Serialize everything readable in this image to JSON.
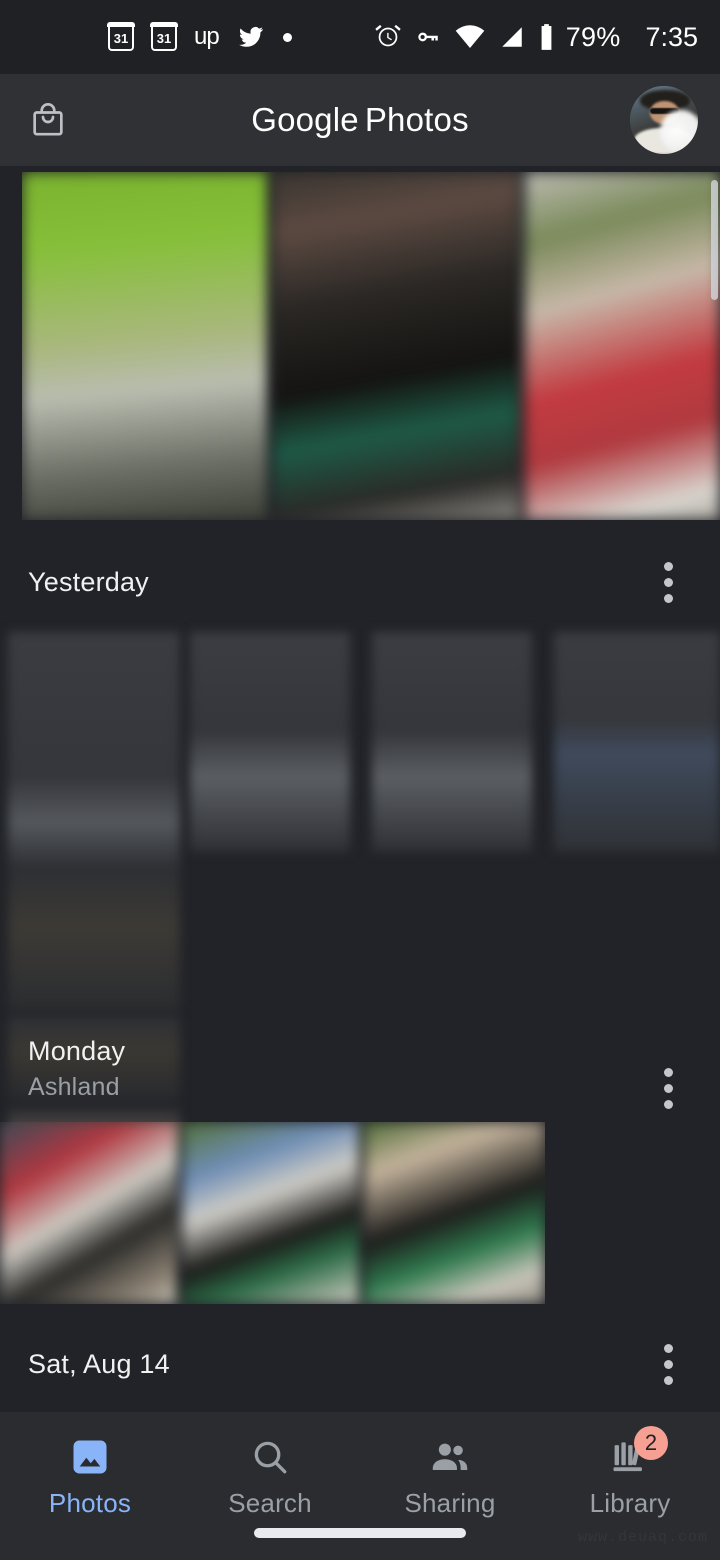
{
  "status_bar": {
    "time": "7:35",
    "battery_text": "79%",
    "left_icons": [
      {
        "name": "calendar-icon",
        "label": "31"
      },
      {
        "name": "calendar-icon-2",
        "label": "31"
      },
      {
        "name": "upwork-icon",
        "label": "up"
      },
      {
        "name": "twitter-icon",
        "label": ""
      },
      {
        "name": "dot-icon",
        "label": ""
      }
    ],
    "right_icons": [
      {
        "name": "alarm-icon"
      },
      {
        "name": "key-icon"
      },
      {
        "name": "wifi-icon"
      },
      {
        "name": "cellular-signal-icon"
      },
      {
        "name": "battery-icon"
      }
    ]
  },
  "app_bar": {
    "title_primary": "Google",
    "title_secondary": "Photos",
    "store_icon": "shopping-bag-icon",
    "avatar_alt": "account-avatar"
  },
  "sections": [
    {
      "id": "top-strip",
      "title": "",
      "subtitle": "",
      "photo_count": 3
    },
    {
      "id": "yesterday",
      "title": "Yesterday",
      "subtitle": "",
      "overflow": "more-options",
      "photo_count": 6
    },
    {
      "id": "monday",
      "title": "Monday",
      "subtitle": "Ashland",
      "overflow": "more-options",
      "photo_count": 3
    },
    {
      "id": "sat-aug-14",
      "title": "Sat, Aug 14",
      "subtitle": "",
      "overflow": "more-options",
      "photo_count": 0
    }
  ],
  "bottom_nav": {
    "items": [
      {
        "label": "Photos",
        "icon": "photo-library-icon",
        "active": true,
        "badge": ""
      },
      {
        "label": "Search",
        "icon": "search-icon",
        "active": false,
        "badge": ""
      },
      {
        "label": "Sharing",
        "icon": "people-icon",
        "active": false,
        "badge": ""
      },
      {
        "label": "Library",
        "icon": "library-books-icon",
        "active": false,
        "badge": "2"
      }
    ]
  },
  "watermark": "www.deuaq.com",
  "colors": {
    "background": "#212328",
    "status_bar": "#202124",
    "app_bar": "#303134",
    "nav_bar": "#2a2c30",
    "accent": "#8ab4f8",
    "badge": "#f6a094",
    "text_primary": "#f1f1f1",
    "text_secondary": "#9aa0a6"
  }
}
